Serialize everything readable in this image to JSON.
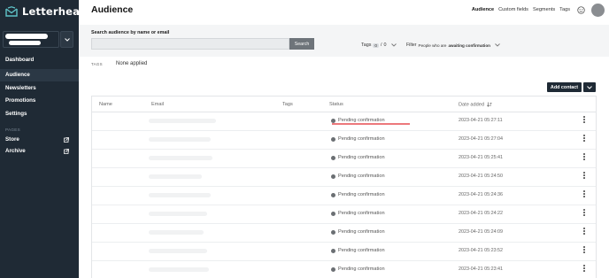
{
  "app": {
    "name": "Letterhead",
    "accent": "#1f2a35",
    "highlight": "#e0282e"
  },
  "sidebar": {
    "items": [
      {
        "label": "Dashboard",
        "active": false
      },
      {
        "label": "Audience",
        "active": true
      },
      {
        "label": "Newsletters",
        "active": false
      },
      {
        "label": "Promotions",
        "active": false
      },
      {
        "label": "Settings",
        "active": false
      }
    ],
    "pages_section": "PAGES",
    "pages": [
      {
        "label": "Store",
        "icon": "external-link-icon"
      },
      {
        "label": "Archive",
        "icon": "external-link-icon"
      }
    ]
  },
  "header": {
    "title": "Audience",
    "tabs": [
      {
        "label": "Audience",
        "active": true
      },
      {
        "label": "Custom fields",
        "active": false
      },
      {
        "label": "Segments",
        "active": false
      },
      {
        "label": "Tags",
        "active": false
      }
    ]
  },
  "search": {
    "label": "Search audience by name or email",
    "placeholder": "",
    "value": "",
    "button": "Search"
  },
  "filters": {
    "tags_label": "Tags",
    "tags_included": "0",
    "tags_separator": "/",
    "tags_excluded": "0",
    "filter_label": "Filter",
    "filter_prefix": "People who are",
    "filter_value": "awaiting confirmation"
  },
  "tags_applied": {
    "label": "TAGS",
    "value": "None applied"
  },
  "actions": {
    "add_contact": "Add contact"
  },
  "table": {
    "headers": {
      "name": "Name",
      "email": "Email",
      "tags": "Tags",
      "status": "Status",
      "date": "Date added"
    },
    "rows": [
      {
        "status": "Pending confirmation",
        "date": "2023-04-21 05:27:11"
      },
      {
        "status": "Pending confirmation",
        "date": "2023-04-21 05:27:04"
      },
      {
        "status": "Pending confirmation",
        "date": "2023-04-21 05:25:41"
      },
      {
        "status": "Pending confirmation",
        "date": "2023-04-21 05:24:50"
      },
      {
        "status": "Pending confirmation",
        "date": "2023-04-21 05:24:36"
      },
      {
        "status": "Pending confirmation",
        "date": "2023-04-21 05:24:22"
      },
      {
        "status": "Pending confirmation",
        "date": "2023-04-21 05:24:09"
      },
      {
        "status": "Pending confirmation",
        "date": "2023-04-21 05:23:52"
      },
      {
        "status": "Pending confirmation",
        "date": "2023-04-21 05:23:41"
      }
    ]
  }
}
